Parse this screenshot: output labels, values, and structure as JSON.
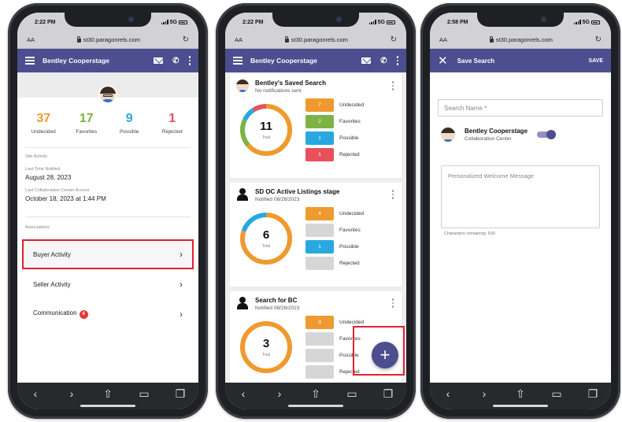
{
  "status": {
    "time_1": "2:22 PM",
    "time_2": "2:22 PM",
    "time_3": "2:58 PM",
    "network": "5G"
  },
  "browser": {
    "aa_label": "AA",
    "url": "st30.paragonrels.com",
    "reload": "↻"
  },
  "nav": {
    "user_name": "Bentley Cooperstage"
  },
  "toolbar": {
    "back": "‹",
    "forward": "›",
    "share": "⇧",
    "bookmarks": "▭",
    "tabs": "❐"
  },
  "screen1": {
    "stats": [
      {
        "value": "37",
        "label": "Undecided",
        "color": "#ef9a2e"
      },
      {
        "value": "17",
        "label": "Favorites",
        "color": "#7cb342"
      },
      {
        "value": "9",
        "label": "Possible",
        "color": "#29a8e0"
      },
      {
        "value": "1",
        "label": "Rejected",
        "color": "#e8505b"
      }
    ],
    "site_activity_label": "Site Activity",
    "last_notified_label": "Last Time Notified",
    "last_notified_value": "August 28, 2023",
    "last_access_label": "Last Collaboration Center Access",
    "last_access_value": "October 18, 2023 at 1:44 PM",
    "associations_label": "Associations",
    "rows": [
      {
        "label": "Buyer Activity"
      },
      {
        "label": "Seller Activity"
      },
      {
        "label": "Communication",
        "badge": "4"
      }
    ],
    "chevron": "›"
  },
  "screen2": {
    "legend_labels": [
      "Undecided",
      "Favorites",
      "Possible",
      "Rejected"
    ],
    "chip_colors": [
      "#ef9a2e",
      "#7cb342",
      "#29a8e0",
      "#e8505b"
    ],
    "empty_chip_color": "#d6d6d6",
    "total_label": "Total",
    "cards": [
      {
        "title": "Bentley's Saved Search",
        "subtitle": "No notifications sent",
        "total": "11",
        "counts": [
          "7",
          "2",
          "1",
          "1"
        ]
      },
      {
        "title": "SD OC Active Listings stage",
        "subtitle": "Notified 08/28/2023",
        "total": "6",
        "counts": [
          "4",
          "",
          "1",
          ""
        ]
      },
      {
        "title": "Search for BC",
        "subtitle": "Notified 08/28/2023",
        "total": "3",
        "counts": [
          "3",
          "",
          "",
          ""
        ]
      }
    ],
    "fab_label": "+"
  },
  "screen3": {
    "close": "✕",
    "title": "Save Search",
    "save": "SAVE",
    "search_name_placeholder": "Search Name *",
    "person_name": "Bentley Cooperstage",
    "person_sub": "Collaboration Center",
    "welcome_placeholder": "Personalized Welcome Message",
    "chars_remaining": "Characters remaining: 500"
  }
}
